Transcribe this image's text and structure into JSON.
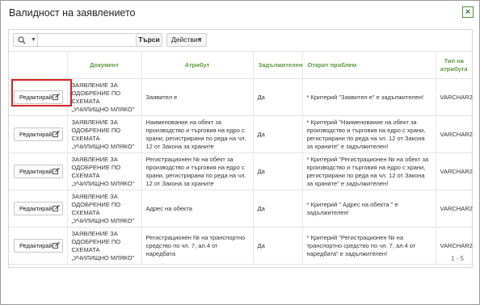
{
  "dialog": {
    "title": "Валидност на заявлението",
    "close_label": "×"
  },
  "toolbar": {
    "search_icon": "search-icon",
    "search_placeholder": "",
    "search_button": "Търси",
    "actions_button": "Действия"
  },
  "table": {
    "columns": [
      "",
      "Документ",
      "Атрибут",
      "Задължителен",
      "Открит проблем",
      "Тип на атрибута"
    ],
    "rows": [
      {
        "edit": "Редактирай",
        "document": "ЗАЯВЛЕНИЕ ЗА ОДОБРЕНИЕ ПО СХЕМАТА „УЧИЛИЩНО МЛЯКО\"",
        "attribute": "Заявител е",
        "required": "Да",
        "problem": "* Критерий \"Заявител е\" е задължителен!",
        "type": "VARCHAR2"
      },
      {
        "edit": "Редактирай",
        "document": "ЗАЯВЛЕНИЕ ЗА ОДОБРЕНИЕ ПО СХЕМАТА „УЧИЛИЩНО МЛЯКО\"",
        "attribute": "Наименование на обект за производство и търговия на едро с храни, регистрирани по реда на чл. 12 от Закона за храните",
        "required": "Да",
        "problem": "* Критерий \"Наименование на обект за производство и търговия на едро с храни, регистрирани по реда на чл. 12 от Закона за храните\" е задължителен!",
        "type": "VARCHAR2"
      },
      {
        "edit": "Редактирай",
        "document": "ЗАЯВЛЕНИЕ ЗА ОДОБРЕНИЕ ПО СХЕМАТА „УЧИЛИЩНО МЛЯКО\"",
        "attribute": "Регистрационен № на обект за производство и търговия на едро с храни, регистрирани по реда на чл. 12 от Закона за храните",
        "required": "Да",
        "problem": "* Критерий \"Регистрационен № на обект за производство и търговия на едро с храни, регистрирани по реда на чл. 12 от Закона за храните\" е задължителен!",
        "type": "VARCHAR2"
      },
      {
        "edit": "Редактирай",
        "document": "ЗАЯВЛЕНИЕ ЗА ОДОБРЕНИЕ ПО СХЕМАТА „УЧИЛИЩНО МЛЯКО\"",
        "attribute": "Адрес на обекта",
        "required": "Да",
        "problem": "* Критерий \" Адрес на обекта \" е задължителен!",
        "type": "VARCHAR2"
      },
      {
        "edit": "Редактирай",
        "document": "ЗАЯВЛЕНИЕ ЗА ОДОБРЕНИЕ ПО СХЕМАТА „УЧИЛИЩНО МЛЯКО\"",
        "attribute": "Регистрационен № на транспортно средство по чл. 7, ал.4 от наредбата",
        "required": "Да",
        "problem": "* Критерий \"Регистрационен № на транспортно средство по чл. 7, ал.4 от наредбата\" е задължителен!",
        "type": "VARCHAR2"
      }
    ]
  },
  "footer": {
    "pager": "1 - 5"
  },
  "colors": {
    "header_text": "#5f9a3f",
    "attribute_text": "#e02020",
    "highlight_border": "#d62222"
  }
}
